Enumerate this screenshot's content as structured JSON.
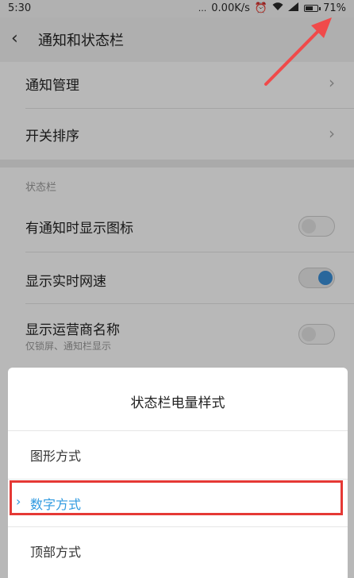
{
  "status_bar": {
    "time": "5:30",
    "dots": "...",
    "net_speed": "0.00K/s",
    "battery_level": 0.71,
    "battery_text": "71%"
  },
  "header": {
    "title": "通知和状态栏"
  },
  "items": {
    "notification_management": "通知管理",
    "switch_order": "开关排序",
    "section_label": "状态栏",
    "show_icon": "有通知时显示图标",
    "realtime_speed": "显示实时网速",
    "carrier_name": "显示运营商名称",
    "carrier_sub": "仅锁屏、通知栏显示"
  },
  "toggles": {
    "show_icon": false,
    "realtime_speed": true,
    "carrier_name": false
  },
  "dialog": {
    "title": "状态栏电量样式",
    "options": [
      "图形方式",
      "数字方式",
      "顶部方式"
    ],
    "selected_index": 1
  },
  "colors": {
    "accent": "#2f9ae0",
    "highlight": "#e53935",
    "arrow": "#f04a4a"
  }
}
